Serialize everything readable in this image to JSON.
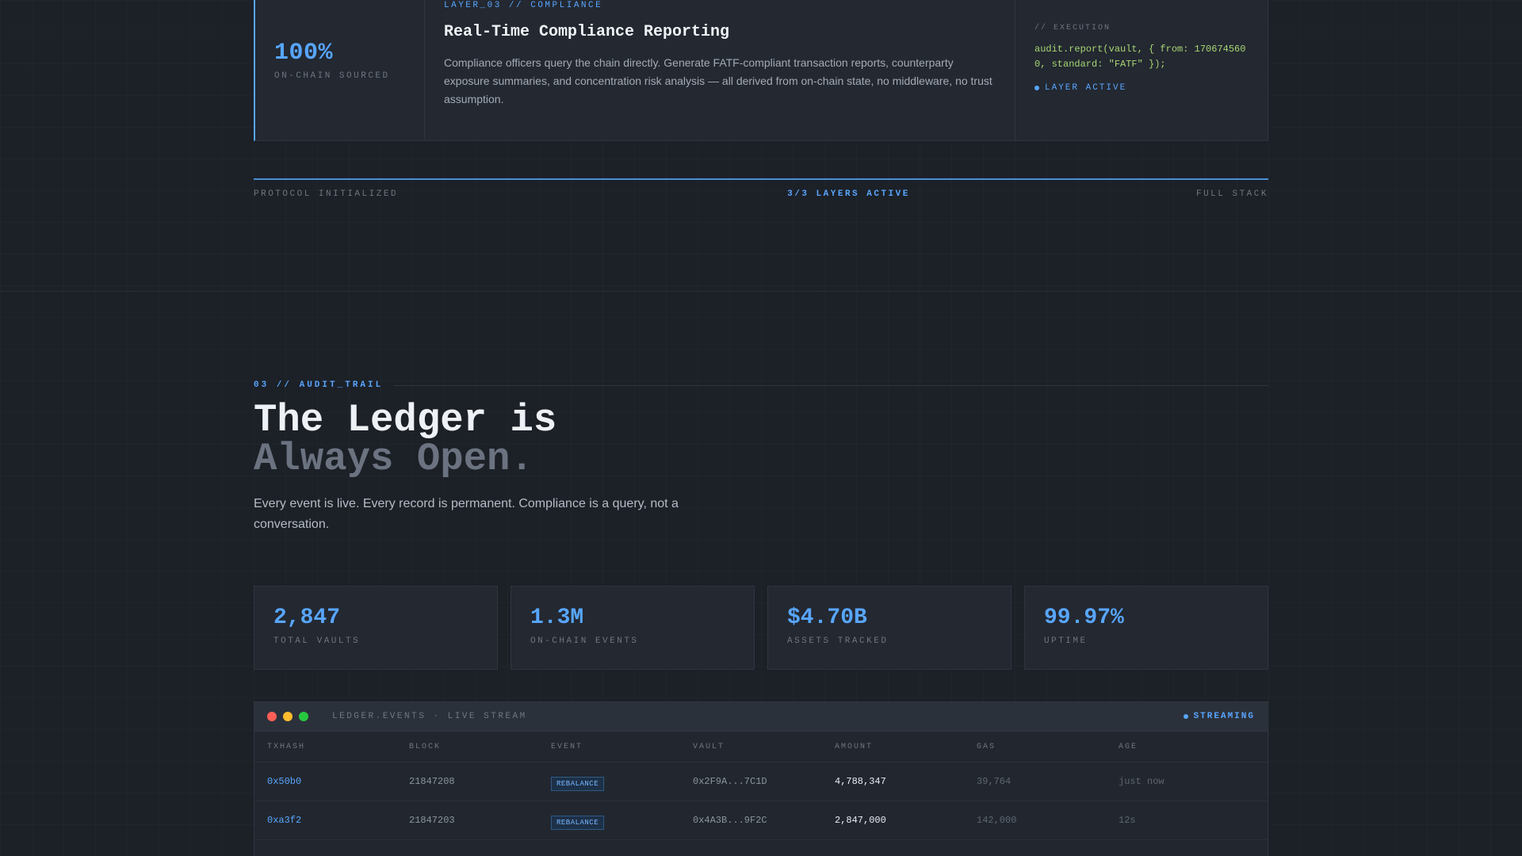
{
  "layer": {
    "stat_value": "100%",
    "stat_label": "ON-CHAIN SOURCED",
    "tag": "LAYER_03 // COMPLIANCE",
    "title": "Real-Time Compliance Reporting",
    "description": "Compliance officers query the chain directly. Generate FATF-compliant transaction reports, counterparty exposure summaries, and concentration risk analysis — all derived from on-chain state, no middleware, no trust assumption.",
    "exec_label": "// EXECUTION",
    "exec_code": "audit.report(vault, { from: 1706745600, standard: \"FATF\" });",
    "status": "LAYER ACTIVE",
    "accent": "#58a6ff"
  },
  "progress": {
    "left": "PROTOCOL INITIALIZED",
    "center": "3/3 LAYERS ACTIVE",
    "right": "FULL STACK",
    "fraction": 1.0
  },
  "audit": {
    "eyebrow": "03 // AUDIT_TRAIL",
    "headline_line1": "The Ledger is",
    "headline_line2": "Always Open.",
    "subtext": "Every event is live. Every record is permanent. Compliance is a query, not a conversation."
  },
  "stats": [
    {
      "value": "2,847",
      "label": "TOTAL VAULTS"
    },
    {
      "value": "1.3M",
      "label": "ON-CHAIN EVENTS"
    },
    {
      "value": "$4.70B",
      "label": "ASSETS TRACKED"
    },
    {
      "value": "99.97%",
      "label": "UPTIME"
    }
  ],
  "stream": {
    "title": "LEDGER.EVENTS · LIVE STREAM",
    "status": "STREAMING",
    "columns": [
      "TXHASH",
      "BLOCK",
      "EVENT",
      "VAULT",
      "AMOUNT",
      "GAS",
      "AGE"
    ],
    "rows": [
      {
        "hash": "0x50b0",
        "block": "21847208",
        "event": "REBALANCE",
        "vault": "0x2F9A...7C1D",
        "amount": "4,788,347",
        "gas": "39,764",
        "age": "just now"
      },
      {
        "hash": "0xa3f2",
        "block": "21847203",
        "event": "REBALANCE",
        "vault": "0x4A3B...9F2C",
        "amount": "2,847,000",
        "gas": "142,000",
        "age": "12s"
      }
    ]
  }
}
